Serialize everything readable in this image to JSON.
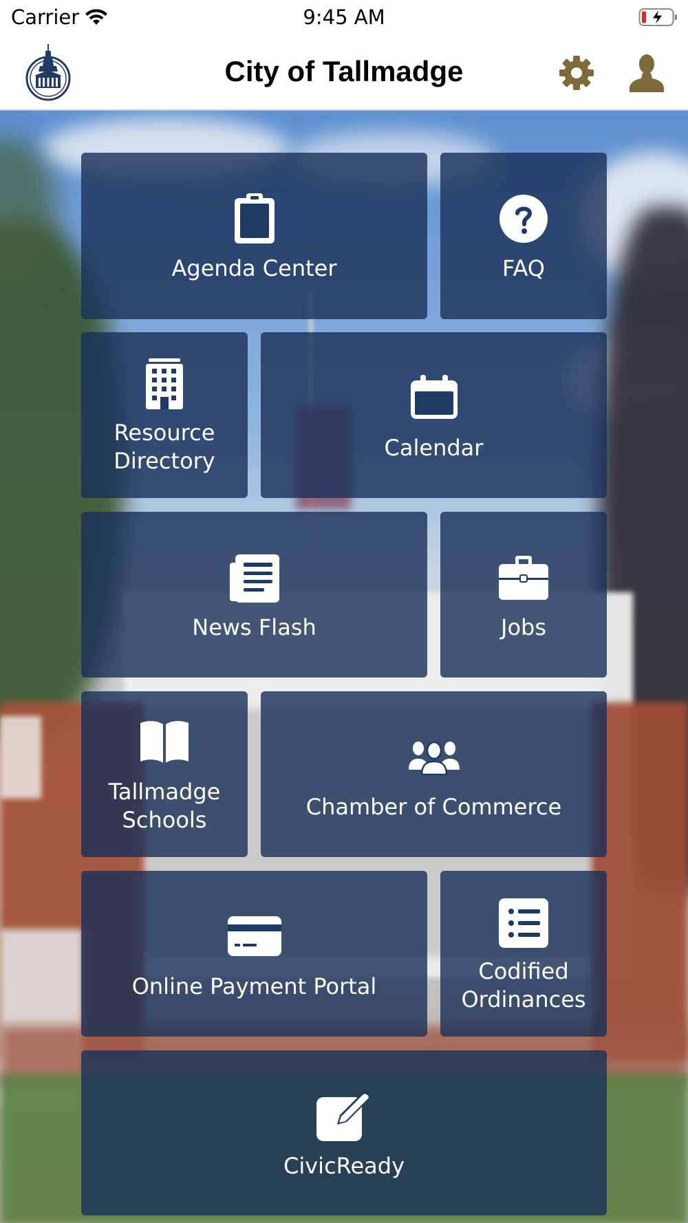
{
  "status_bar": {
    "carrier": "Carrier",
    "time": "9:45 AM"
  },
  "header": {
    "title": "City of Tallmadge",
    "accent_color": "#7c6a3a"
  },
  "tiles": {
    "agenda_center": {
      "label": "Agenda Center",
      "icon": "clipboard-icon"
    },
    "faq": {
      "label": "FAQ",
      "icon": "question-circle-icon"
    },
    "resource_directory": {
      "label": "Resource\nDirectory",
      "icon": "building-icon"
    },
    "calendar": {
      "label": "Calendar",
      "icon": "calendar-icon"
    },
    "news_flash": {
      "label": "News Flash",
      "icon": "newspaper-icon"
    },
    "jobs": {
      "label": "Jobs",
      "icon": "briefcase-icon"
    },
    "tallmadge_schools": {
      "label": "Tallmadge\nSchools",
      "icon": "book-icon"
    },
    "chamber_of_commerce": {
      "label": "Chamber of Commerce",
      "icon": "people-group-icon"
    },
    "online_payment_portal": {
      "label": "Online Payment Portal",
      "icon": "credit-card-icon"
    },
    "codified_ordinances": {
      "label": "Codified\nOrdinances",
      "icon": "list-icon"
    },
    "civicready": {
      "label": "CivicReady",
      "icon": "edit-icon"
    }
  },
  "colors": {
    "tile_background": "#193058",
    "tile_text": "#ffffff",
    "battery_low": "#e0262a"
  }
}
